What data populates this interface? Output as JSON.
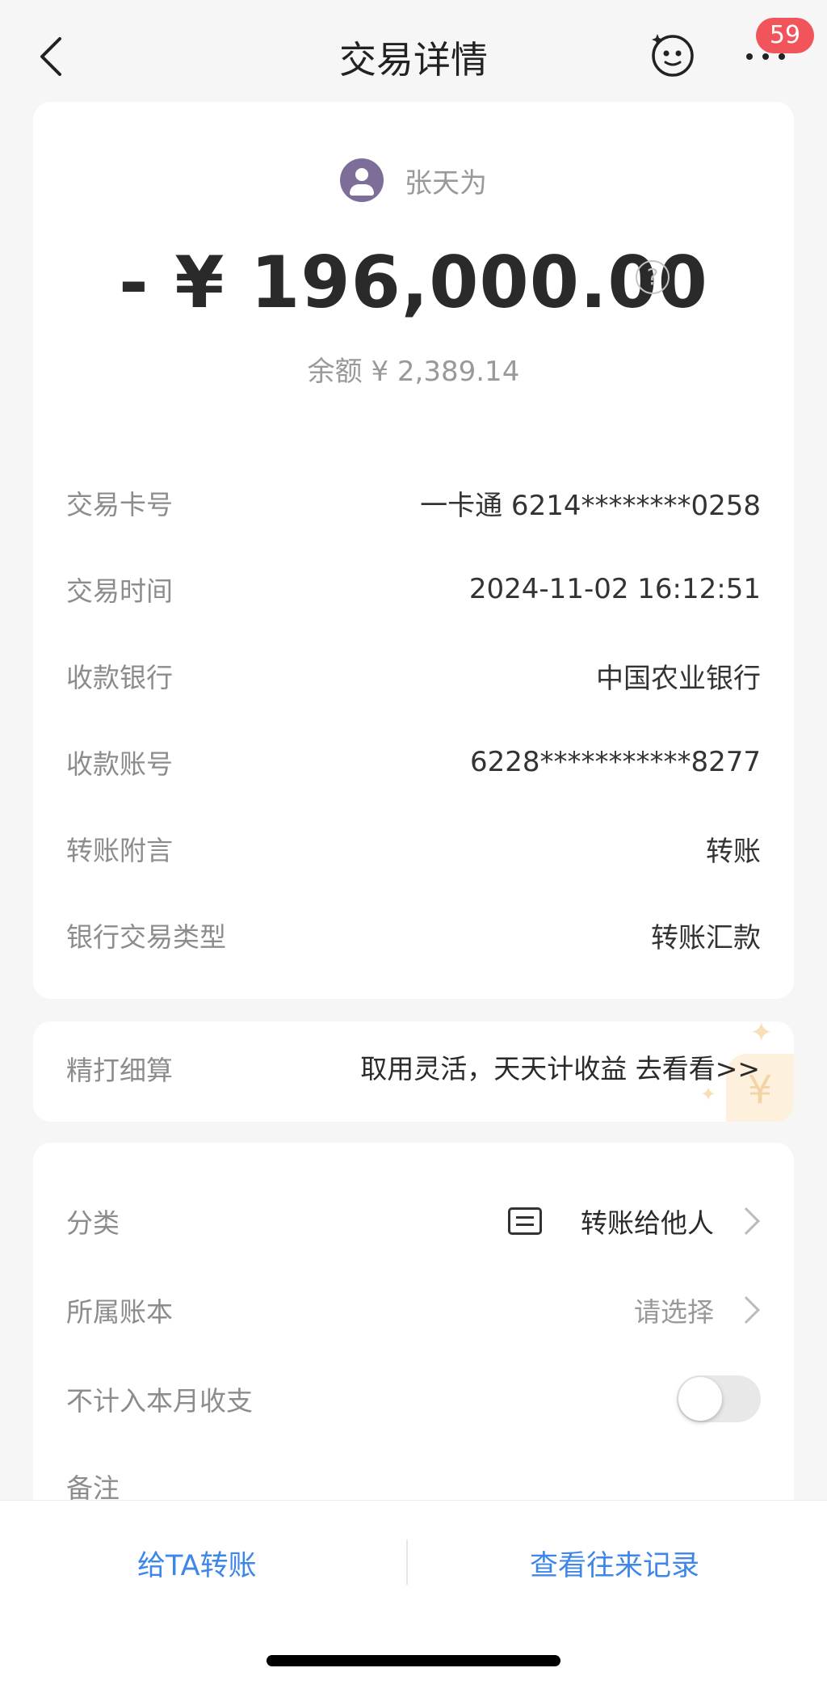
{
  "nav": {
    "title": "交易详情",
    "badge_count": "59"
  },
  "icons": {
    "back": "chevron-left-icon",
    "robot": "smiley-robot-icon",
    "more": "more-dots-icon",
    "help": "question-circle-icon",
    "category": "transfer-list-icon",
    "chevron": "chevron-right-icon"
  },
  "summary": {
    "payee_name": "张天为",
    "amount": "- ¥ 196,000.00",
    "help_glyph": "?",
    "balance": "余额 ¥ 2,389.14"
  },
  "details": [
    {
      "label": "交易卡号",
      "value": "一卡通 6214********0258"
    },
    {
      "label": "交易时间",
      "value": "2024-11-02 16:12:51"
    },
    {
      "label": "收款银行",
      "value": "中国农业银行"
    },
    {
      "label": "收款账号",
      "value": "6228***********8277"
    },
    {
      "label": "转账附言",
      "value": "转账"
    },
    {
      "label": "银行交易类型",
      "value": "转账汇款"
    }
  ],
  "promo": {
    "label": "精打细算",
    "text": "取用灵活，天天计收益 去看看>>",
    "coin_glyph": "¥"
  },
  "settings": {
    "category_label": "分类",
    "category_value": "转账给他人",
    "ledger_label": "所属账本",
    "ledger_value": "请选择",
    "exclude_label": "不计入本月收支",
    "exclude_on": false,
    "note_label": "备注"
  },
  "bottom": {
    "transfer_label": "给TA转账",
    "history_label": "查看往来记录"
  },
  "colors": {
    "accent": "#3e86e8",
    "badge": "#f2545b",
    "avatar": "#7d6d98"
  }
}
